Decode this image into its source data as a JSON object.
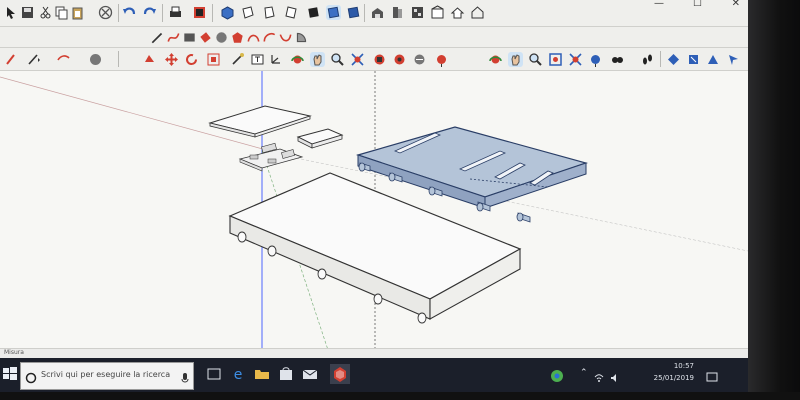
{
  "window": {
    "controls": {
      "minimize": "—",
      "maximize": "☐",
      "close": "✕"
    }
  },
  "status_bar": {
    "text": "Misura"
  },
  "taskbar": {
    "search": {
      "placeholder": "Scrivi qui per eseguire la ricerca"
    },
    "clock": {
      "time": "10:57",
      "date": "25/01/2019"
    }
  },
  "colors": {
    "selected_face": "#b4c4d8",
    "selected_edge": "#2a3e66",
    "model_edge": "#333333",
    "taskbar": "#1b1f2a",
    "sketchup_red": "#d23f31"
  },
  "toolbars": {
    "main": [
      "select-icon",
      "save-icon",
      "cut-icon",
      "copy-icon",
      "paste-icon",
      "erase-icon",
      "undo-icon",
      "redo-icon",
      "print-icon",
      "model-info-icon",
      "iso-view-icon",
      "top-view-icon",
      "front-view-icon",
      "right-view-icon",
      "back-view-icon",
      "left-view-icon",
      "bottom-view-icon",
      "xray-icon",
      "back-edges-icon",
      "wireframe-icon",
      "hidden-line-icon",
      "shaded-icon",
      "shaded-textures-icon",
      "warehouse-icon",
      "component-icon",
      "extension-icon",
      "materials-icon",
      "home-icon",
      "house-icon"
    ],
    "drawing": [
      "pencil-icon",
      "freehand-icon",
      "rectangle-icon",
      "rotated-rect-icon",
      "circle-icon",
      "polygon-icon",
      "arc-icon",
      "2pt-arc-icon",
      "3pt-arc-icon",
      "pie-icon"
    ],
    "edit": [
      "paint-icon",
      "line-icon",
      "arc-tool-icon",
      "shape-icon",
      "push-pull-icon",
      "move-icon",
      "rotate-icon",
      "scale-icon",
      "offset-icon",
      "follow-me-icon",
      "tape-icon",
      "text-icon",
      "axes-icon",
      "dimension-icon",
      "protractor-icon",
      "orbit-icon",
      "pan-icon",
      "zoom-icon",
      "zoom-extents-icon",
      "zoom-window-icon",
      "section-icon",
      "walk-icon",
      "look-around-icon",
      "position-camera-icon",
      "footprints-icon"
    ]
  }
}
